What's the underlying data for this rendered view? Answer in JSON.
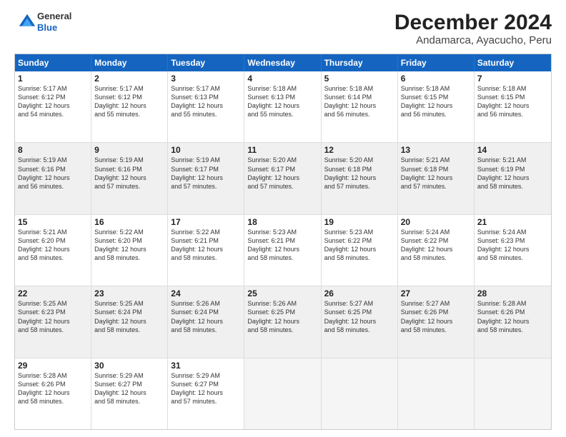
{
  "logo": {
    "general": "General",
    "blue": "Blue"
  },
  "title": "December 2024",
  "subtitle": "Andamarca, Ayacucho, Peru",
  "header": {
    "days": [
      "Sunday",
      "Monday",
      "Tuesday",
      "Wednesday",
      "Thursday",
      "Friday",
      "Saturday"
    ]
  },
  "weeks": [
    [
      {
        "day": "1",
        "info": "Sunrise: 5:17 AM\nSunset: 6:12 PM\nDaylight: 12 hours\nand 54 minutes."
      },
      {
        "day": "2",
        "info": "Sunrise: 5:17 AM\nSunset: 6:12 PM\nDaylight: 12 hours\nand 55 minutes."
      },
      {
        "day": "3",
        "info": "Sunrise: 5:17 AM\nSunset: 6:13 PM\nDaylight: 12 hours\nand 55 minutes."
      },
      {
        "day": "4",
        "info": "Sunrise: 5:18 AM\nSunset: 6:13 PM\nDaylight: 12 hours\nand 55 minutes."
      },
      {
        "day": "5",
        "info": "Sunrise: 5:18 AM\nSunset: 6:14 PM\nDaylight: 12 hours\nand 56 minutes."
      },
      {
        "day": "6",
        "info": "Sunrise: 5:18 AM\nSunset: 6:15 PM\nDaylight: 12 hours\nand 56 minutes."
      },
      {
        "day": "7",
        "info": "Sunrise: 5:18 AM\nSunset: 6:15 PM\nDaylight: 12 hours\nand 56 minutes."
      }
    ],
    [
      {
        "day": "8",
        "info": "Sunrise: 5:19 AM\nSunset: 6:16 PM\nDaylight: 12 hours\nand 56 minutes."
      },
      {
        "day": "9",
        "info": "Sunrise: 5:19 AM\nSunset: 6:16 PM\nDaylight: 12 hours\nand 57 minutes."
      },
      {
        "day": "10",
        "info": "Sunrise: 5:19 AM\nSunset: 6:17 PM\nDaylight: 12 hours\nand 57 minutes."
      },
      {
        "day": "11",
        "info": "Sunrise: 5:20 AM\nSunset: 6:17 PM\nDaylight: 12 hours\nand 57 minutes."
      },
      {
        "day": "12",
        "info": "Sunrise: 5:20 AM\nSunset: 6:18 PM\nDaylight: 12 hours\nand 57 minutes."
      },
      {
        "day": "13",
        "info": "Sunrise: 5:21 AM\nSunset: 6:18 PM\nDaylight: 12 hours\nand 57 minutes."
      },
      {
        "day": "14",
        "info": "Sunrise: 5:21 AM\nSunset: 6:19 PM\nDaylight: 12 hours\nand 58 minutes."
      }
    ],
    [
      {
        "day": "15",
        "info": "Sunrise: 5:21 AM\nSunset: 6:20 PM\nDaylight: 12 hours\nand 58 minutes."
      },
      {
        "day": "16",
        "info": "Sunrise: 5:22 AM\nSunset: 6:20 PM\nDaylight: 12 hours\nand 58 minutes."
      },
      {
        "day": "17",
        "info": "Sunrise: 5:22 AM\nSunset: 6:21 PM\nDaylight: 12 hours\nand 58 minutes."
      },
      {
        "day": "18",
        "info": "Sunrise: 5:23 AM\nSunset: 6:21 PM\nDaylight: 12 hours\nand 58 minutes."
      },
      {
        "day": "19",
        "info": "Sunrise: 5:23 AM\nSunset: 6:22 PM\nDaylight: 12 hours\nand 58 minutes."
      },
      {
        "day": "20",
        "info": "Sunrise: 5:24 AM\nSunset: 6:22 PM\nDaylight: 12 hours\nand 58 minutes."
      },
      {
        "day": "21",
        "info": "Sunrise: 5:24 AM\nSunset: 6:23 PM\nDaylight: 12 hours\nand 58 minutes."
      }
    ],
    [
      {
        "day": "22",
        "info": "Sunrise: 5:25 AM\nSunset: 6:23 PM\nDaylight: 12 hours\nand 58 minutes."
      },
      {
        "day": "23",
        "info": "Sunrise: 5:25 AM\nSunset: 6:24 PM\nDaylight: 12 hours\nand 58 minutes."
      },
      {
        "day": "24",
        "info": "Sunrise: 5:26 AM\nSunset: 6:24 PM\nDaylight: 12 hours\nand 58 minutes."
      },
      {
        "day": "25",
        "info": "Sunrise: 5:26 AM\nSunset: 6:25 PM\nDaylight: 12 hours\nand 58 minutes."
      },
      {
        "day": "26",
        "info": "Sunrise: 5:27 AM\nSunset: 6:25 PM\nDaylight: 12 hours\nand 58 minutes."
      },
      {
        "day": "27",
        "info": "Sunrise: 5:27 AM\nSunset: 6:26 PM\nDaylight: 12 hours\nand 58 minutes."
      },
      {
        "day": "28",
        "info": "Sunrise: 5:28 AM\nSunset: 6:26 PM\nDaylight: 12 hours\nand 58 minutes."
      }
    ],
    [
      {
        "day": "29",
        "info": "Sunrise: 5:28 AM\nSunset: 6:26 PM\nDaylight: 12 hours\nand 58 minutes."
      },
      {
        "day": "30",
        "info": "Sunrise: 5:29 AM\nSunset: 6:27 PM\nDaylight: 12 hours\nand 58 minutes."
      },
      {
        "day": "31",
        "info": "Sunrise: 5:29 AM\nSunset: 6:27 PM\nDaylight: 12 hours\nand 57 minutes."
      },
      {
        "day": "",
        "info": ""
      },
      {
        "day": "",
        "info": ""
      },
      {
        "day": "",
        "info": ""
      },
      {
        "day": "",
        "info": ""
      }
    ]
  ]
}
